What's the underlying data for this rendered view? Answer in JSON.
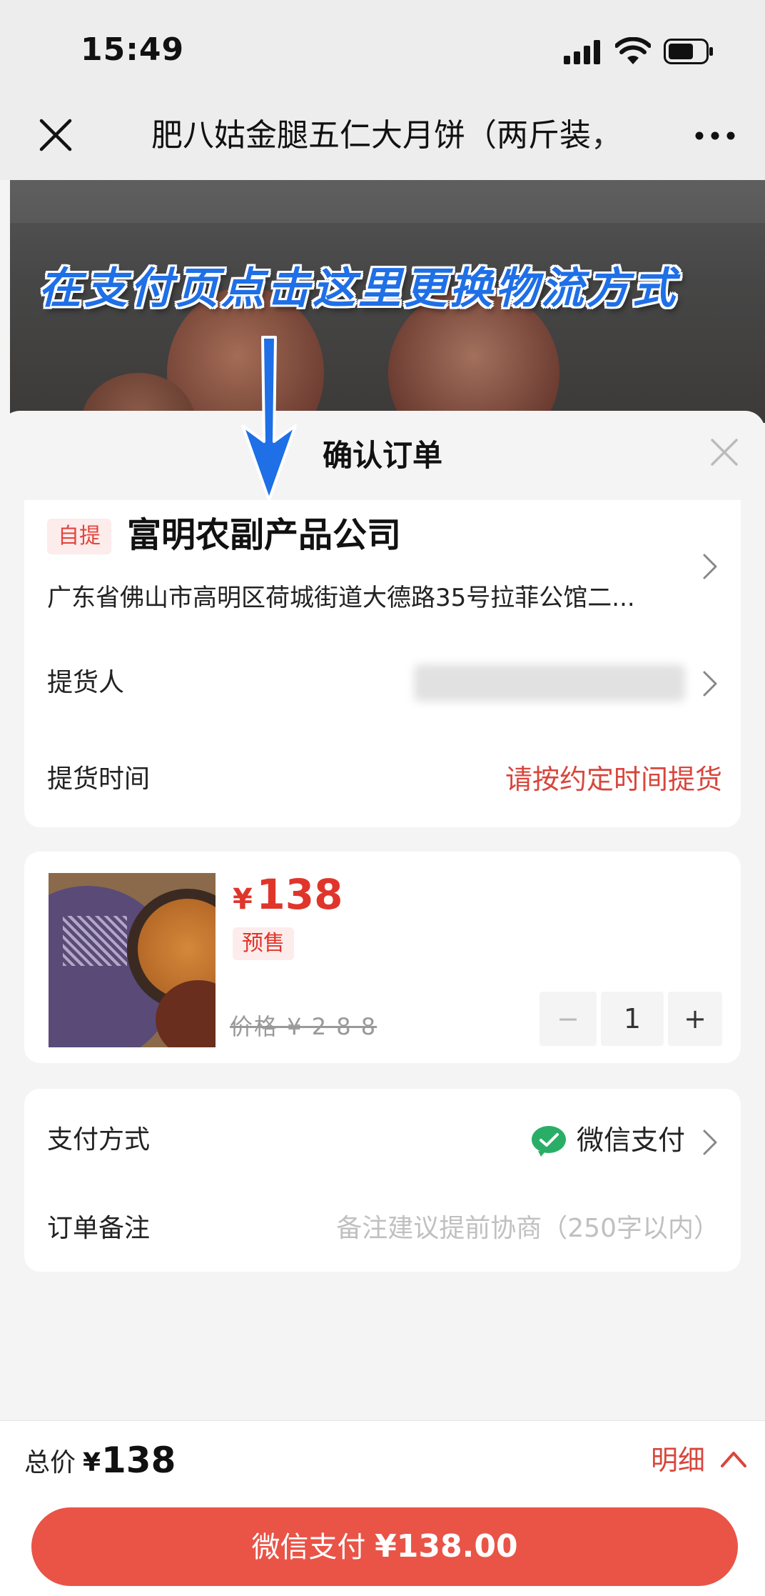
{
  "status": {
    "time": "15:49"
  },
  "nav": {
    "title": "肥八姑金腿五仁大月饼（两斤装，"
  },
  "annotation": "在支付页点击这里更换物流方式",
  "sheet": {
    "title": "确认订单"
  },
  "address": {
    "tag": "自提",
    "store": "富明农副产品公司",
    "address": "广东省佛山市高明区荷城街道大德路35号拉菲公馆二..."
  },
  "rows": {
    "pickup_person_label": "提货人",
    "pickup_time_label": "提货时间",
    "pickup_time_value": "请按约定时间提货"
  },
  "product": {
    "currency": "¥",
    "price": "138",
    "tag": "预售",
    "original_price": "价格 ¥ 2 8 8",
    "quantity": "1",
    "minus": "−",
    "plus": "+"
  },
  "payment": {
    "label": "支付方式",
    "method": "微信支付",
    "remark_label": "订单备注",
    "remark_placeholder": "备注建议提前协商（250字以内）"
  },
  "footer": {
    "total_label": "总价",
    "total_currency": "¥",
    "total_value": "138",
    "detail": "明细",
    "pay_prefix": "微信支付 ",
    "pay_amount": "¥138.00"
  },
  "colors": {
    "accent": "#e95447",
    "red_text": "#d8463c",
    "wechat_green": "#2aae67",
    "annotation_blue": "#1f6fe6"
  },
  "icons": [
    "cellular-icon",
    "wifi-icon",
    "battery-icon",
    "close-icon",
    "more-icon",
    "chevron-right-icon",
    "wechat-pay-icon",
    "chevron-up-icon",
    "arrow-down-icon"
  ]
}
